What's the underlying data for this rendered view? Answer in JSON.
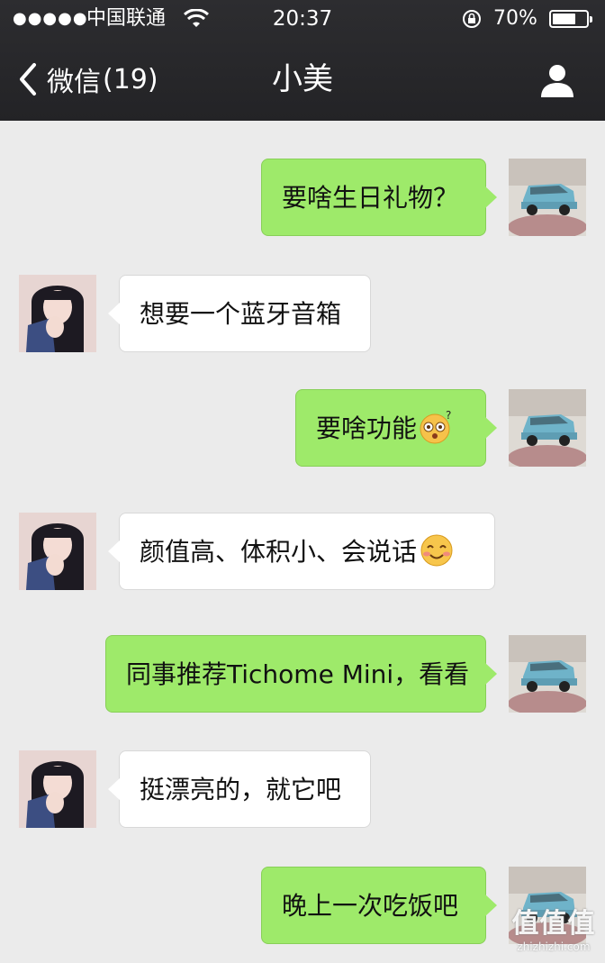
{
  "status_bar": {
    "signal": "●●●●●",
    "carrier": "中国联通",
    "time": "20:37",
    "battery_percent": "70%",
    "battery_level": 0.7
  },
  "nav": {
    "back_label": "微信",
    "back_count": "(19)",
    "title": "小美",
    "right_icon": "person-icon"
  },
  "messages": [
    {
      "side": "out",
      "text": "要啥生日礼物？"
    },
    {
      "side": "in",
      "text": "想要一个蓝牙音箱"
    },
    {
      "side": "out",
      "text": "要啥功能",
      "emoji": "dizzy-face-emoji"
    },
    {
      "side": "in",
      "text": "颜值高、体积小、会说话",
      "emoji": "blush-smile-emoji"
    },
    {
      "side": "out",
      "text": "同事推荐Tichome Mini，看看"
    },
    {
      "side": "in",
      "text": "挺漂亮的，就它吧"
    },
    {
      "side": "out",
      "text": "晚上一次吃饭吧"
    }
  ],
  "watermark": {
    "logo": "值值值",
    "url": "zhizhizhi.com"
  },
  "colors": {
    "topbar": "#2d2d30",
    "chat_background": "#ebebeb",
    "outgoing_bubble": "#9eea6a",
    "incoming_bubble": "#ffffff"
  }
}
